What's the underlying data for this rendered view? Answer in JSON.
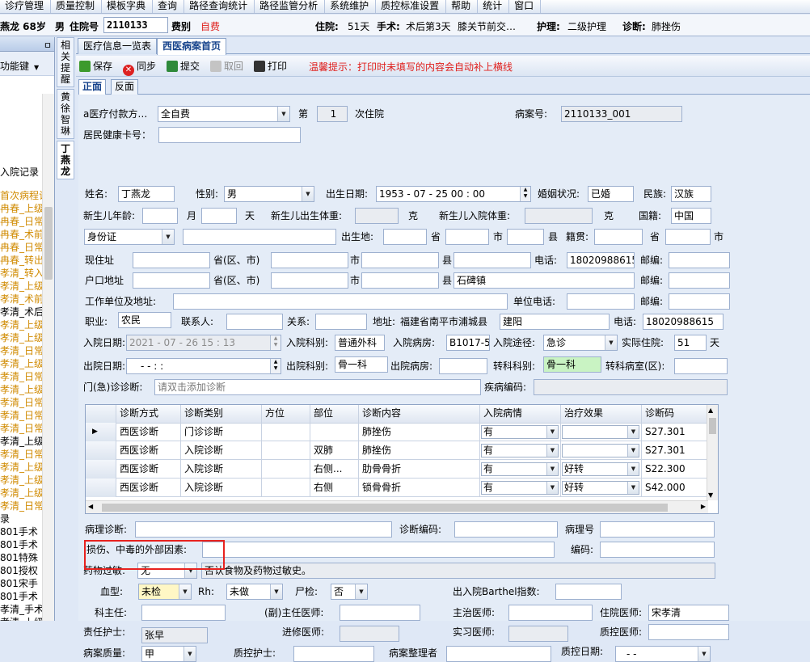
{
  "menu": [
    "诊疗管理",
    "质量控制",
    "模板字典",
    "查询",
    "路径查询统计",
    "路径监管分析",
    "系统维护",
    "质控标准设置",
    "帮助",
    "统计",
    "窗口"
  ],
  "patient": {
    "name_age": "燕龙 68岁",
    "sex": "男",
    "inpatient_no_label": "住院号",
    "inpatient_no": "2110133",
    "fee_label": "费别",
    "fee": "自费",
    "stay_label": "住院:",
    "stay": "51天",
    "surgery_label": "手术:",
    "surgery": "术后第3天",
    "surgery_name": "膝关节前交…",
    "nursing_label": "护理:",
    "nursing": "二级护理",
    "diag_label": "诊断:",
    "diag": "肺挫伤"
  },
  "left_panel": {
    "pin": "ㅁ",
    "tool_label": "功能键",
    "record_label": "入院记录",
    "items": [
      {
        "text": "首次病程记",
        "color": "#d08a00"
      },
      {
        "text": "冉春_上级",
        "color": "#d08a00"
      },
      {
        "text": "冉春_日常",
        "color": "#d08a00"
      },
      {
        "text": "冉春_术前",
        "color": "#d08a00"
      },
      {
        "text": "冉春_日常",
        "color": "#d08a00"
      },
      {
        "text": "冉春_转出",
        "color": "#d08a00"
      },
      {
        "text": "孝清_转入",
        "color": "#d08a00"
      },
      {
        "text": "孝清_上级",
        "color": "#d08a00"
      },
      {
        "text": "孝清_术前",
        "color": "#d08a00"
      },
      {
        "text": "孝清_术后",
        "color": "#000000"
      },
      {
        "text": "孝清_上级",
        "color": "#d08a00"
      },
      {
        "text": "孝清_上级",
        "color": "#d08a00"
      },
      {
        "text": "孝清_日常",
        "color": "#d08a00"
      },
      {
        "text": "孝清_上级",
        "color": "#d08a00"
      },
      {
        "text": "孝清_日常",
        "color": "#d08a00"
      },
      {
        "text": "孝清_上级",
        "color": "#d08a00"
      },
      {
        "text": "孝清_日常",
        "color": "#d08a00"
      },
      {
        "text": "孝清_日常",
        "color": "#d08a00"
      },
      {
        "text": "孝清_日常",
        "color": "#d08a00"
      },
      {
        "text": "孝清_上级",
        "color": "#000000"
      },
      {
        "text": "孝清_日常",
        "color": "#d08a00"
      },
      {
        "text": "孝清_上级",
        "color": "#d08a00"
      },
      {
        "text": "孝清_上级",
        "color": "#d08a00"
      },
      {
        "text": "孝清_上级",
        "color": "#d08a00"
      },
      {
        "text": "孝清_日常",
        "color": "#d08a00"
      },
      {
        "text": "录",
        "color": "#000000"
      },
      {
        "text": "801手术",
        "color": "#000000"
      },
      {
        "text": "801手术",
        "color": "#000000"
      },
      {
        "text": "801特殊",
        "color": "#000000"
      },
      {
        "text": "801授权",
        "color": "#000000"
      },
      {
        "text": "801宋手",
        "color": "#000000"
      },
      {
        "text": "801手术",
        "color": "#000000"
      },
      {
        "text": "孝清_手术",
        "color": "#000000"
      },
      {
        "text": "孝清_上级",
        "color": "#000000"
      }
    ]
  },
  "vtabs": [
    "相关提醒",
    "黄徐智琳",
    "丁燕龙"
  ],
  "tabs": [
    "医疗信息一览表",
    "西医病案首页"
  ],
  "toolbar": {
    "save": "保存",
    "sync": "同步",
    "submit": "提交",
    "withdraw": "取回",
    "print": "打印",
    "hint": "温馨提示：打印时未填写的内容会自动补上横线"
  },
  "subtabs": [
    "正面",
    "反面"
  ],
  "form": {
    "pay_label": "a医疗付款方…",
    "pay_value": "全自费",
    "times_prefix": "第",
    "times_value": "1",
    "times_suffix": "次住院",
    "case_no_label": "病案号:",
    "case_no_value": "2110133_001",
    "health_card_label": "居民健康卡号：",
    "name_label": "姓名:",
    "name_value": "丁燕龙",
    "sex_label": "性别:",
    "sex_value": "男",
    "birth_label": "出生日期:",
    "birth_value": "1953 - 07 - 25   00 : 00",
    "marriage_label": "婚姻状况:",
    "marriage_value": "已婚",
    "ethnic_label": "民族:",
    "ethnic_value": "汉族",
    "newborn_age_label": "新生儿年龄:",
    "month_label": "月",
    "day_label": "天",
    "newborn_birth_w_label": "新生儿出生体重:",
    "gram1": "克",
    "newborn_in_w_label": "新生儿入院体重:",
    "gram2": "克",
    "nation_label": "国籍:",
    "nation_value": "中国",
    "idtype_value": "身份证",
    "birthplace_label": "出生地:",
    "province": "省",
    "city": "市",
    "county": "县",
    "native_label": "籍贯:",
    "native_province": "省",
    "native_city": "市",
    "addr_label": "现住址",
    "prov_city_label": "省(区、市)",
    "addr_city": "市",
    "addr_county": "县",
    "phone_label": "电话:",
    "phone_value": "18020988615",
    "zip_label": "邮编:",
    "reg_label": "户口地址",
    "reg_prov_label": "省(区、市)",
    "reg_city": "市",
    "reg_county": "县",
    "reg_county_value": "石碑镇",
    "reg_zip_label": "邮编:",
    "work_label": "工作单位及地址:",
    "work_phone_label": "单位电话:",
    "work_zip_label": "邮编:",
    "job_label": "职业:",
    "job_value": "农民",
    "contact_label": "联系人:",
    "relation_label": "关系:",
    "caddr_label": "地址:",
    "caddr_value": "福建省南平市浦城县",
    "caddr_value2": "建阳",
    "cphone_label": "电话:",
    "cphone_value": "18020988615",
    "in_date_label": "入院日期:",
    "in_date_value": "2021 - 07 - 26   15 : 13",
    "in_dept_label": "入院科别:",
    "in_dept_value": "普通外科",
    "in_ward_label": "入院病房:",
    "in_ward_value": "B1017-5",
    "in_way_label": "入院途径:",
    "in_way_value": "急诊",
    "actual_days_label": "实际住院:",
    "actual_days_value": "51",
    "actual_days_unit": "天",
    "out_date_label": "出院日期:",
    "out_date_value": "-   -         :   :",
    "out_dept_label": "出院科别:",
    "out_dept_value": "骨一科",
    "out_ward_label": "出院病房:",
    "transfer_label": "转科科别:",
    "transfer_value": "骨一科",
    "transfer_room_label": "转科病室(区):",
    "clinic_diag_label": "门(急)诊诊断:",
    "clinic_diag_placeholder": "请双击添加诊断",
    "disease_code_label": "疾病编码:",
    "patho_label": "病理诊断:",
    "diag_code_label": "诊断编码:",
    "patho_no_label": "病理号",
    "injury_label": "损伤、中毒的外部因素:",
    "code_label": "编码:",
    "allergy_label": "药物过敏:",
    "allergy_value": "无",
    "allergy_note": "否认食物及药物过敏史。",
    "blood_label": "血型:",
    "blood_value": "未检",
    "rh_label": "Rh:",
    "rh_value": "未做",
    "autopsy_label": "尸检:",
    "autopsy_value": "否",
    "barthel_label": "出入院Barthel指数:",
    "director_label": "科主任:",
    "vice_label": "(副)主任医师:",
    "attending_label": "主治医师:",
    "resident_label": "住院医师:",
    "resident_value": "宋孝清",
    "nurse_label": "责任护士:",
    "nurse_value": "张早",
    "advanced_label": "进修医师:",
    "intern_label": "实习医师:",
    "qc_doctor_label": "质控医师:",
    "quality_label": "病案质量:",
    "quality_value": "甲",
    "qc_nurse_label": "质控护士:",
    "archivist_label": "病案整理者",
    "qc_date_label": "质控日期:",
    "qc_date_value": "-   -"
  },
  "grid": {
    "headers": [
      "诊断方式",
      "诊断类别",
      "方位",
      "部位",
      "诊断内容",
      "入院病情",
      "治疗效果",
      "诊断码"
    ],
    "rows": [
      {
        "mode": "西医诊断",
        "type": "门诊诊断",
        "pos": "",
        "part": "",
        "content": "肺挫伤",
        "cond": "有",
        "effect": "",
        "code": "S27.301",
        "current": true
      },
      {
        "mode": "西医诊断",
        "type": "入院诊断",
        "pos": "",
        "part": "双肺",
        "content": "肺挫伤",
        "cond": "有",
        "effect": "",
        "code": "S27.301",
        "current": false
      },
      {
        "mode": "西医诊断",
        "type": "入院诊断",
        "pos": "",
        "part": "右侧...",
        "content": "肋骨骨折",
        "cond": "有",
        "effect": "好转",
        "code": "S22.300",
        "current": false
      },
      {
        "mode": "西医诊断",
        "type": "入院诊断",
        "pos": "",
        "part": "右侧",
        "content": "锁骨骨折",
        "cond": "有",
        "effect": "好转",
        "code": "S42.000",
        "current": false
      }
    ]
  },
  "colors": {
    "accent_red": "#e8221f",
    "tab_blue": "#15428b",
    "hint_red": "#e0201d"
  },
  "icons": [
    "save-icon",
    "sync-icon",
    "submit-icon",
    "withdraw-icon",
    "print-icon"
  ]
}
